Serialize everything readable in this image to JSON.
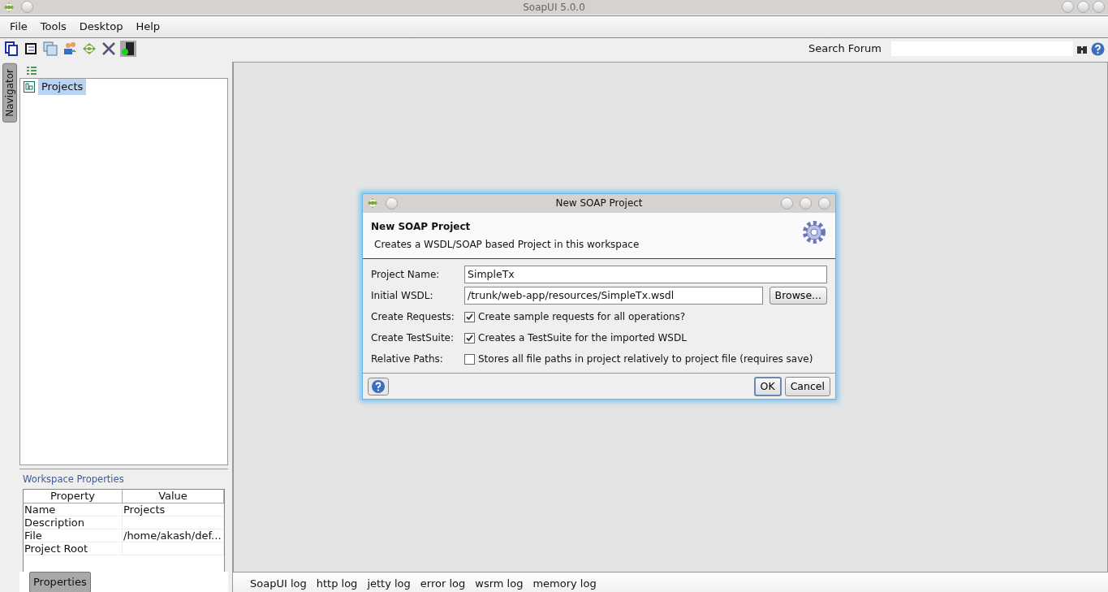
{
  "window": {
    "title": "SoapUI 5.0.0"
  },
  "menu": [
    "File",
    "Tools",
    "Desktop",
    "Help"
  ],
  "search": {
    "label": "Search Forum"
  },
  "navigator": {
    "tab": "Navigator",
    "tree": [
      {
        "label": "Projects",
        "selected": true
      }
    ]
  },
  "workspace_properties": {
    "title": "Workspace Properties",
    "columns": [
      "Property",
      "Value"
    ],
    "rows": [
      [
        "Name",
        "Projects"
      ],
      [
        "Description",
        ""
      ],
      [
        "File",
        "/home/akash/def..."
      ],
      [
        "Project Root",
        ""
      ]
    ]
  },
  "left_tabs": [
    {
      "label": "Properties",
      "selected": true
    }
  ],
  "log_tabs": [
    "SoapUI log",
    "http log",
    "jetty log",
    "error log",
    "wsrm log",
    "memory log"
  ],
  "dialog": {
    "title": "New SOAP Project",
    "heading": "New SOAP Project",
    "description": "Creates a WSDL/SOAP based Project in this workspace",
    "fields": [
      {
        "kind": "text",
        "label": "Project Name:",
        "value": "SimpleTx"
      },
      {
        "kind": "file",
        "label": "Initial WSDL:",
        "value": "/trunk/web-app/resources/SimpleTx.wsdl",
        "button": "Browse..."
      },
      {
        "kind": "checkbox",
        "label": "Create Requests:",
        "text": "Create sample requests for all operations?",
        "checked": true
      },
      {
        "kind": "checkbox",
        "label": "Create TestSuite:",
        "text": "Creates a TestSuite for the imported WSDL",
        "checked": true
      },
      {
        "kind": "checkbox",
        "label": "Relative Paths:",
        "text": "Stores all file paths in project relatively to project file (requires save)",
        "checked": false
      }
    ],
    "buttons": [
      "OK",
      "Cancel"
    ]
  }
}
